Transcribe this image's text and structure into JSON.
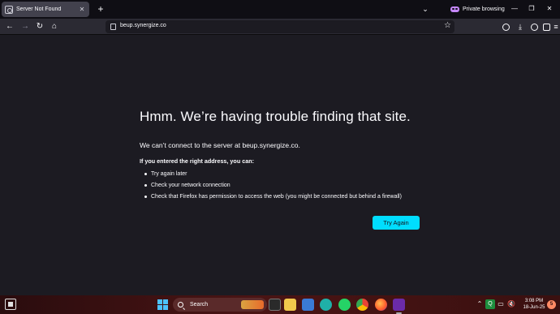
{
  "browser": {
    "tab": {
      "title": "Server Not Found"
    },
    "private_label": "Private browsing",
    "url": "beup.synergize.co"
  },
  "error_page": {
    "title": "Hmm. We’re having trouble finding that site.",
    "description": "We can’t connect to the server at beup.synergize.co.",
    "advice_heading": "If you entered the right address, you can:",
    "advice_items": [
      "Try again later",
      "Check your network connection",
      "Check that Firefox has permission to access the web (you might be connected but behind a firewall)"
    ],
    "try_again_label": "Try Again"
  },
  "taskbar": {
    "search_label": "Search",
    "time": "3:08 PM",
    "date": "18-Jun-25",
    "notification_count": "5"
  },
  "colors": {
    "page_background": "#1c1b22",
    "accent_button": "#00ddff",
    "private_accent": "#c688ff"
  }
}
